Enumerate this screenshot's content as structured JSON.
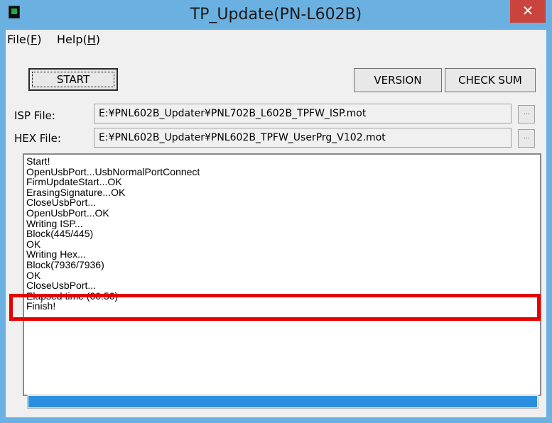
{
  "window": {
    "title": "TP_Update(PN-L602B)",
    "close_glyph": "✕",
    "app_icon": "app-icon"
  },
  "menu": {
    "file_prefix": "File(",
    "file_key": "F",
    "help_prefix": "Help(",
    "help_key": "H",
    "suffix": ")"
  },
  "toolbar": {
    "start_label": "START",
    "version_label": "VERSION",
    "checksum_label": "CHECK SUM"
  },
  "files": {
    "isp_label": "ISP File:",
    "isp_value": "E:¥PNL602B_Updater¥PNL702B_L602B_TPFW_ISP.mot",
    "hex_label": "HEX File:",
    "hex_value": "E:¥PNL602B_Updater¥PNL602B_TPFW_UserPrg_V102.mot",
    "browse_label": "..."
  },
  "log": {
    "lines": [
      "Start!",
      "OpenUsbPort...UsbNormalPortConnect",
      "FirmUpdateStart...OK",
      "ErasingSignature...OK",
      "CloseUsbPort...",
      "OpenUsbPort...OK",
      "Writing ISP...",
      "Block(445/445)",
      "OK",
      "Writing Hex...",
      "Block(7936/7936)",
      "OK",
      "CloseUsbPort...",
      "Elapsed time (00:50)",
      "Finish!"
    ]
  },
  "progress": {
    "value_fraction": 1.0
  },
  "colors": {
    "titlebar": "#6ab0e0",
    "close": "#c9443c",
    "progress": "#2a8fdc",
    "highlight": "#e60000"
  }
}
